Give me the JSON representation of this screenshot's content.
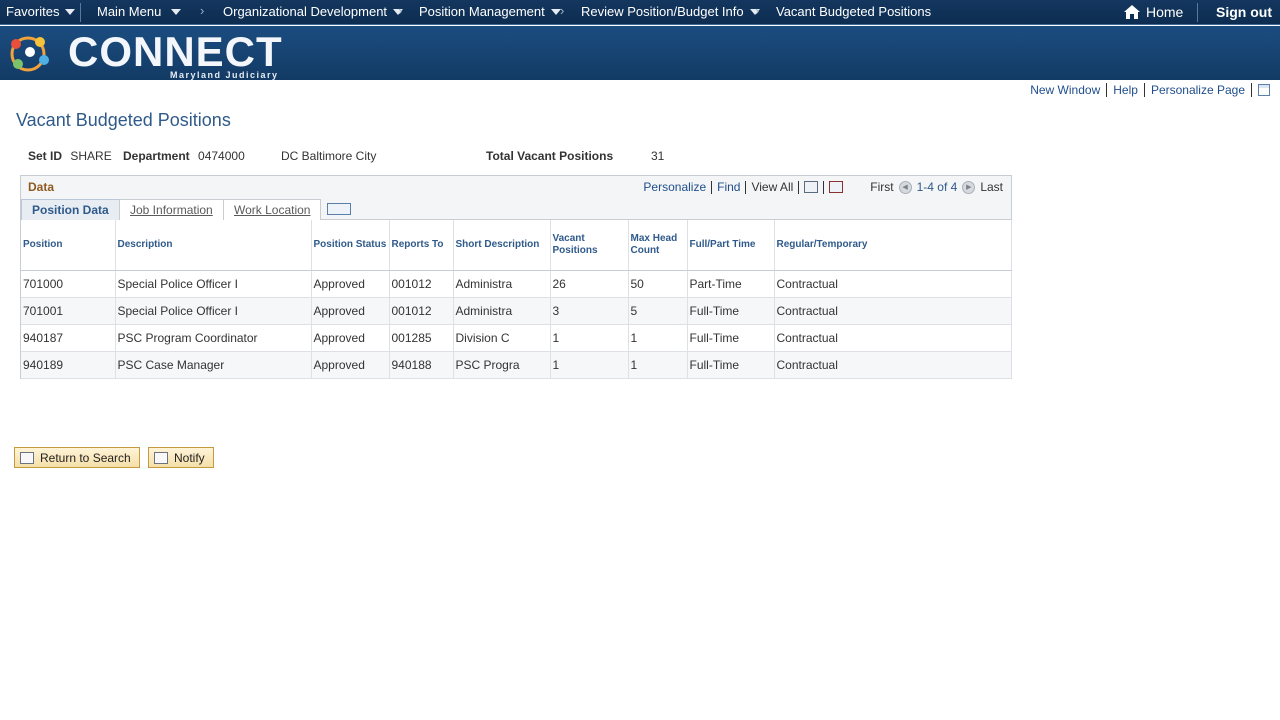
{
  "nav": {
    "favorites": "Favorites",
    "main_menu": "Main Menu",
    "breadcrumb": [
      "Organizational Development",
      "Position Management",
      "Review Position/Budget Info",
      "Vacant Budgeted Positions"
    ],
    "home": "Home",
    "sign_out": "Sign out"
  },
  "banner": {
    "logo": "CONNECT",
    "subtitle": "Maryland Judiciary"
  },
  "page_links": {
    "new_window": "New Window",
    "help": "Help",
    "personalize_page": "Personalize Page"
  },
  "page": {
    "title": "Vacant Budgeted Positions",
    "setid_label": "Set ID",
    "setid": "SHARE",
    "dept_label": "Department",
    "dept": "0474000",
    "dept_name": "DC Baltimore City",
    "total_label": "Total Vacant Positions",
    "total": "31"
  },
  "grid": {
    "title": "Data",
    "personalize": "Personalize",
    "find": "Find",
    "view_all": "View All",
    "first": "First",
    "range": "1-4 of 4",
    "last": "Last",
    "tabs": [
      "Position Data",
      "Job Information",
      "Work Location"
    ],
    "columns": [
      "Position",
      "Description",
      "Position Status",
      "Reports To",
      "Short Description",
      "Vacant Positions",
      "Max Head Count",
      "Full/Part Time",
      "Regular/Temporary"
    ],
    "rows": [
      [
        "701000",
        "Special Police Officer I",
        "Approved",
        "001012",
        "Administra",
        "26",
        "50",
        "Part-Time",
        "Contractual"
      ],
      [
        "701001",
        "Special Police Officer I",
        "Approved",
        "001012",
        "Administra",
        "3",
        "5",
        "Full-Time",
        "Contractual"
      ],
      [
        "940187",
        "PSC Program Coordinator",
        "Approved",
        "001285",
        "Division C",
        "1",
        "1",
        "Full-Time",
        "Contractual"
      ],
      [
        "940189",
        "PSC Case Manager",
        "Approved",
        "940188",
        "PSC Progra",
        "1",
        "1",
        "Full-Time",
        "Contractual"
      ]
    ]
  },
  "buttons": {
    "return_to_search": "Return to Search",
    "notify": "Notify"
  }
}
